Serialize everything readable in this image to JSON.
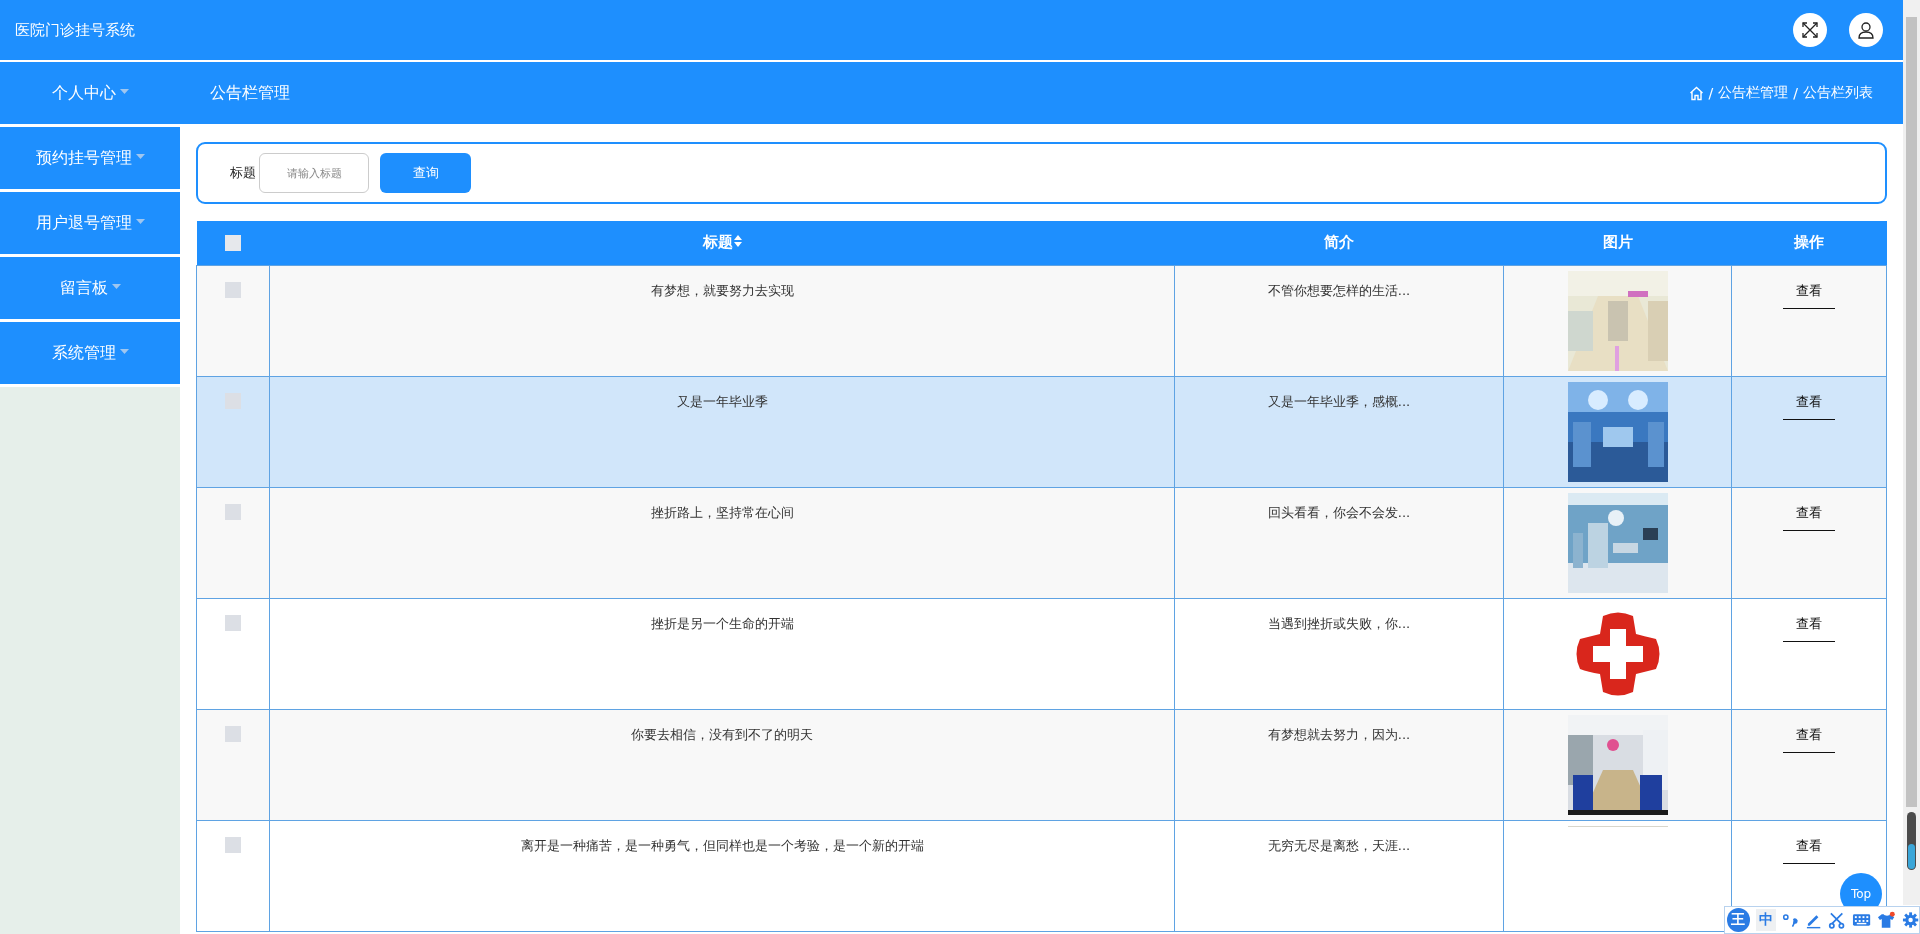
{
  "header": {
    "title": "医院门诊挂号系统"
  },
  "sidebar": {
    "items": [
      {
        "label": "个人中心"
      },
      {
        "label": "预约挂号管理"
      },
      {
        "label": "用户退号管理"
      },
      {
        "label": "留言板"
      },
      {
        "label": "系统管理"
      }
    ]
  },
  "page_title": "公告栏管理",
  "breadcrumb": [
    {
      "separator": "/",
      "label": "公告栏管理"
    },
    {
      "separator": "/",
      "label": "公告栏列表"
    }
  ],
  "search": {
    "label": "标题",
    "placeholder": "请输入标题",
    "button": "查询"
  },
  "table": {
    "all_checked": false,
    "columns": [
      {
        "label": "标题",
        "sortable": true
      },
      {
        "label": "简介",
        "sortable": false
      },
      {
        "label": "图片",
        "sortable": false
      },
      {
        "label": "操作",
        "sortable": false
      }
    ],
    "rows": [
      {
        "title": "有梦想，就要努力去实现",
        "summary": "不管你想要怎样的生活...",
        "action": "查看",
        "checked": false,
        "selected": false
      },
      {
        "title": "又是一年毕业季",
        "summary": "又是一年毕业季，感概...",
        "action": "查看",
        "checked": false,
        "selected": true
      },
      {
        "title": "挫折路上，坚持常在心间",
        "summary": "回头看看，你会不会发...",
        "action": "查看",
        "checked": false,
        "selected": false
      },
      {
        "title": "挫折是另一个生命的开端",
        "summary": "当遇到挫折或失败，你...",
        "image": {
          "kind": "logo"
        },
        "action": "查看",
        "checked": false,
        "selected": false
      },
      {
        "title": "你要去相信，没有到不了的明天",
        "summary": "有梦想就去努力，因为...",
        "action": "查看",
        "checked": false,
        "selected": false
      },
      {
        "title": "离开是一种痛苦，是一种勇气，但同样也是一个考验，是一个新的开端",
        "summary": "无穷无尽是离愁，天涯...",
        "image": {
          "kind": "blank"
        },
        "action": "查看",
        "checked": false,
        "selected": false
      }
    ]
  },
  "back_to_top": "Top",
  "ime_toolbar": {
    "logo": "王",
    "mode": "中"
  }
}
